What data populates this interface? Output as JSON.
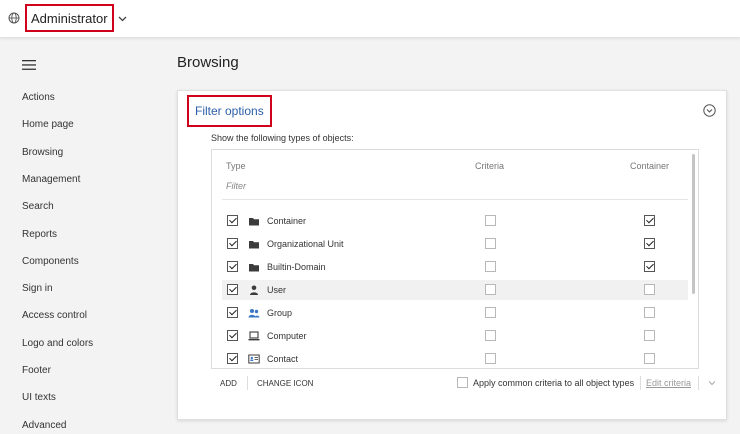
{
  "header": {
    "role_label": "Administrator"
  },
  "sidebar": {
    "items": [
      {
        "label": "Actions"
      },
      {
        "label": "Home page"
      },
      {
        "label": "Browsing"
      },
      {
        "label": "Management"
      },
      {
        "label": "Search"
      },
      {
        "label": "Reports"
      },
      {
        "label": "Components"
      },
      {
        "label": "Sign in"
      },
      {
        "label": "Access control"
      },
      {
        "label": "Logo and colors"
      },
      {
        "label": "Footer"
      },
      {
        "label": "UI texts"
      },
      {
        "label": "Advanced"
      }
    ]
  },
  "main": {
    "title": "Browsing",
    "panel": {
      "title": "Filter options",
      "instruction": "Show the following types of objects:",
      "columns": {
        "type": "Type",
        "criteria": "Criteria",
        "container": "Container"
      },
      "filter_placeholder": "Filter",
      "rows": [
        {
          "label": "Container",
          "icon": "folder-icon",
          "checked": true,
          "criteria": false,
          "container": true
        },
        {
          "label": "Organizational Unit",
          "icon": "folder-icon",
          "checked": true,
          "criteria": false,
          "container": true
        },
        {
          "label": "Builtin-Domain",
          "icon": "folder-icon",
          "checked": true,
          "criteria": false,
          "container": true
        },
        {
          "label": "User",
          "icon": "user-icon",
          "checked": true,
          "criteria": false,
          "container": false
        },
        {
          "label": "Group",
          "icon": "group-icon",
          "checked": true,
          "criteria": false,
          "container": false
        },
        {
          "label": "Computer",
          "icon": "computer-icon",
          "checked": true,
          "criteria": false,
          "container": false
        },
        {
          "label": "Contact",
          "icon": "contact-card-icon",
          "checked": true,
          "criteria": false,
          "container": false
        }
      ],
      "footer": {
        "add": "ADD",
        "change_icon": "CHANGE ICON",
        "apply_common": "Apply common criteria to all object types",
        "edit_criteria": "Edit criteria"
      }
    }
  },
  "colors": {
    "accent": "#2b5ea8",
    "highlight_border": "#d0021b",
    "group_icon": "#3a78c3"
  }
}
